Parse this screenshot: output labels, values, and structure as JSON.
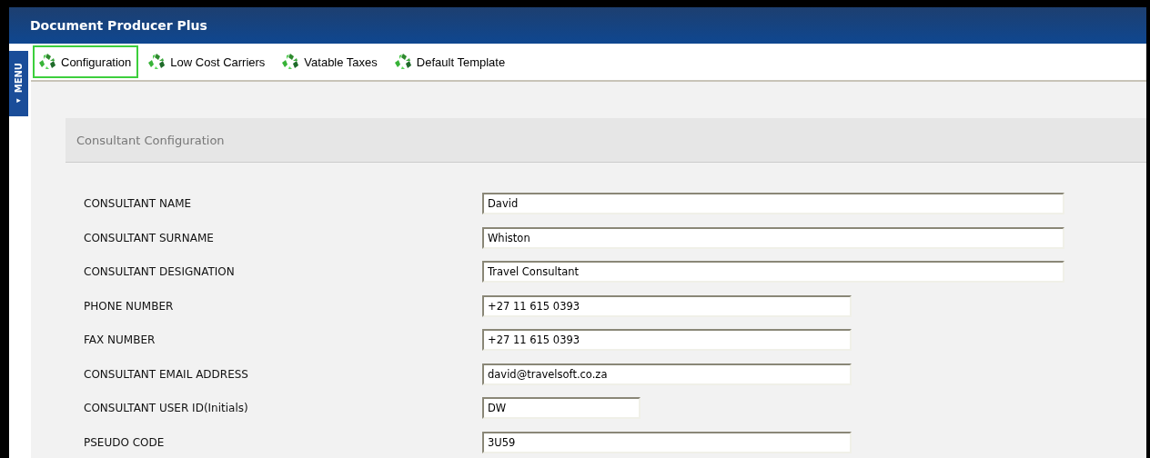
{
  "window": {
    "title": "Document Producer Plus"
  },
  "menu_tab": {
    "label": "MENU",
    "arrow": "▸"
  },
  "tabs": [
    {
      "label": "Configuration",
      "selected": true
    },
    {
      "label": "Low Cost Carriers",
      "selected": false
    },
    {
      "label": "Vatable Taxes",
      "selected": false
    },
    {
      "label": "Default Template",
      "selected": false
    }
  ],
  "section": {
    "title": "Consultant Configuration"
  },
  "fields": [
    {
      "label": "CONSULTANT NAME",
      "value": "David",
      "kind": "wide"
    },
    {
      "label": "CONSULTANT SURNAME",
      "value": "Whiston",
      "kind": "wide"
    },
    {
      "label": "CONSULTANT DESIGNATION",
      "value": "Travel Consultant",
      "kind": "wide"
    },
    {
      "label": "PHONE NUMBER",
      "value": "+27 11 615 0393",
      "kind": "medium"
    },
    {
      "label": "FAX NUMBER",
      "value": "+27 11 615 0393",
      "kind": "medium"
    },
    {
      "label": "CONSULTANT EMAIL ADDRESS",
      "value": "david@travelsoft.co.za",
      "kind": "medium"
    },
    {
      "label": "CONSULTANT USER ID(Initials)",
      "value": "DW",
      "kind": "narrow"
    },
    {
      "label": "PSEUDO CODE",
      "value": "3U59",
      "kind": "medium"
    }
  ]
}
